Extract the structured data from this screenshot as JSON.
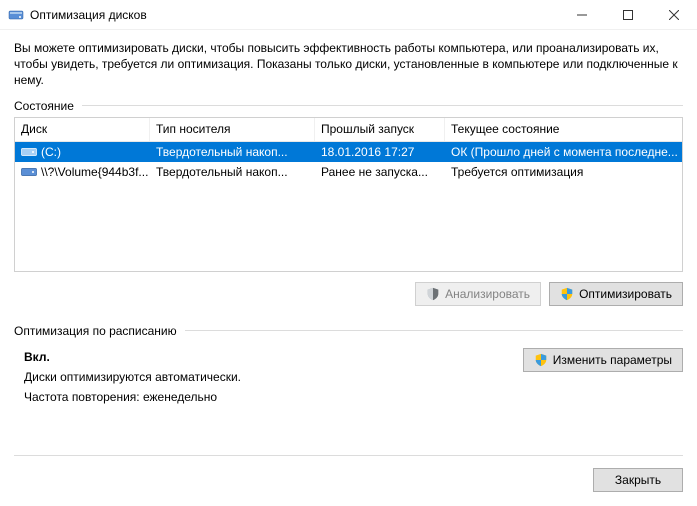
{
  "window": {
    "title": "Оптимизация дисков"
  },
  "description": "Вы можете оптимизировать диски, чтобы повысить эффективность работы  компьютера, или проанализировать их, чтобы увидеть, требуется ли оптимизация. Показаны только диски, установленные в компьютере или подключенные к нему.",
  "status_label": "Состояние",
  "columns": {
    "disk": "Диск",
    "media": "Тип носителя",
    "last": "Прошлый запуск",
    "status": "Текущее состояние"
  },
  "rows": [
    {
      "disk": "(C:)",
      "media": "Твердотельный накоп...",
      "last": "18.01.2016 17:27",
      "status": "ОК (Прошло дней с момента последне...",
      "selected": true,
      "icon": "local"
    },
    {
      "disk": "\\\\?\\Volume{944b3f...",
      "media": "Твердотельный накоп...",
      "last": "Ранее не запуска...",
      "status": "Требуется оптимизация",
      "selected": false,
      "icon": "volume"
    }
  ],
  "buttons": {
    "analyze": "Анализировать",
    "optimize": "Оптимизировать",
    "change": "Изменить параметры",
    "close": "Закрыть"
  },
  "schedule": {
    "label": "Оптимизация по расписанию",
    "on": "Вкл.",
    "auto": "Диски оптимизируются автоматически.",
    "freq": "Частота повторения: еженедельно"
  }
}
